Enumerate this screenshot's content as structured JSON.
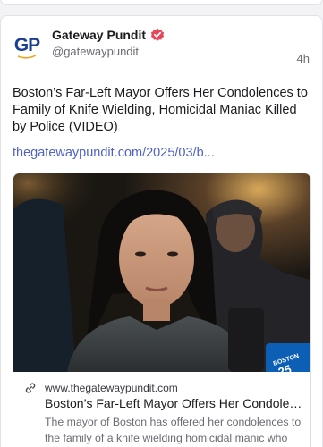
{
  "post": {
    "author": {
      "display_name": "Gateway Pundit",
      "handle": "@gatewaypundit",
      "avatar_text": "GP",
      "verified_icon": "verified-badge-icon"
    },
    "timestamp": "4h",
    "text": "Boston’s Far-Left Mayor Offers Her Condolences to Family of Knife Wielding, Homicidal Maniac Killed by Police (VIDEO)",
    "link_text": "thegatewaypundit.com/2025/03/b..."
  },
  "link_card": {
    "domain": "www.thegatewaypundit.com",
    "title": "Boston’s Far-Left Mayor Offers Her Condolences to Family of Knife Wielding, Homicidal Maniac Killed by Police (VIDEO)",
    "description": "The mayor of Boston has offered her condolences to the family of a knife wielding homicidal manic who was killed by police on Saturday.",
    "image_badge": "BOSTON 25",
    "link_icon": "link-icon"
  },
  "colors": {
    "accent_link": "#4e62c7",
    "verified": "#e8465b",
    "brand_blue": "#1c3f94",
    "brand_orange": "#f1a21c"
  }
}
